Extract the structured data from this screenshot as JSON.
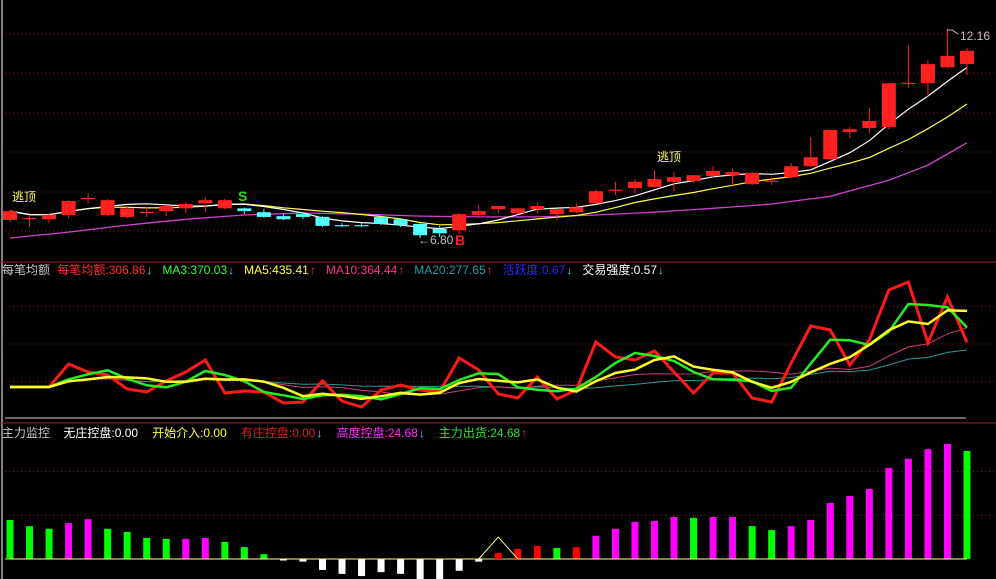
{
  "colors": {
    "up": "#ff2020",
    "down": "#54ffff",
    "ma5": "#ffffff",
    "ma10": "#ffff40",
    "ma_long": "#d040d0",
    "grid": "#8a1c1c",
    "amount": "#ff1a1a",
    "ma3_line": "#22ee22",
    "ma5_line": "#ffff22",
    "ma10_line": "#d03a80",
    "ma20_line": "#2a9a9a",
    "bar_g": "#00ff00",
    "bar_m": "#ff00ff",
    "bar_w": "#ffffff",
    "bar_r": "#ff0000",
    "signal_line": "#ffff80"
  },
  "price_panel": {
    "high_label": "12.16",
    "low_label": "←6.80",
    "signals": {
      "sell": "S",
      "buy": "B"
    },
    "escape_top_label": "逃顶"
  },
  "amount_panel": {
    "title": "每笔均额",
    "items": [
      {
        "label": "每笔均额:",
        "value": "306.86",
        "arrow": "↓",
        "color": "#ff3030",
        "arrow_color": "#40e0ff"
      },
      {
        "label": "MA3:",
        "value": "370.03",
        "arrow": "↓",
        "color": "#30ff30",
        "arrow_color": "#40e0ff"
      },
      {
        "label": "MA5:",
        "value": "435.41",
        "arrow": "↑",
        "color": "#ffff30",
        "arrow_color": "#ff3030"
      },
      {
        "label": "MA10:",
        "value": "364.44",
        "arrow": "↑",
        "color": "#ff3090",
        "arrow_color": "#ff3030"
      },
      {
        "label": "MA20:",
        "value": "277.65",
        "arrow": "↑",
        "color": "#20a0a0",
        "arrow_color": "#ff3030"
      },
      {
        "label": "活跃度:",
        "value": "0.67",
        "arrow": "↓",
        "color": "#2828ff",
        "arrow_color": "#40e0ff"
      },
      {
        "label": "交易强度:",
        "value": "0.57",
        "arrow": "↓",
        "color": "#ffffff",
        "arrow_color": "#40e0ff"
      }
    ]
  },
  "control_panel": {
    "title": "主力监控",
    "items": [
      {
        "label": "无庄控盘:",
        "value": "0.00",
        "arrow": "",
        "color": "#ffffff",
        "arrow_color": "#ffffff"
      },
      {
        "label": "开始介入:",
        "value": "0.00",
        "arrow": "",
        "color": "#ffff30",
        "arrow_color": "#ffffff"
      },
      {
        "label": "有庄控盘:",
        "value": "0.00",
        "arrow": "↓",
        "color": "#e02020",
        "arrow_color": "#40e0ff"
      },
      {
        "label": "高度控盘:",
        "value": "24.68",
        "arrow": "↓",
        "color": "#ff30ff",
        "arrow_color": "#40e0ff"
      },
      {
        "label": "主力出货:",
        "value": "24.68",
        "arrow": "↑",
        "color": "#30e030",
        "arrow_color": "#ff3030"
      }
    ]
  },
  "chart_data": [
    {
      "type": "candlestick",
      "title": "price",
      "ylim": [
        6.8,
        12.16
      ],
      "fields": [
        "open",
        "high",
        "low",
        "close"
      ],
      "ohlc": [
        [
          7.26,
          7.51,
          7.21,
          7.49
        ],
        [
          7.28,
          7.36,
          7.08,
          7.31
        ],
        [
          7.28,
          7.44,
          7.18,
          7.39
        ],
        [
          7.39,
          7.77,
          7.31,
          7.75
        ],
        [
          7.82,
          7.95,
          7.69,
          7.83
        ],
        [
          7.39,
          7.8,
          7.36,
          7.77
        ],
        [
          7.34,
          7.64,
          7.31,
          7.56
        ],
        [
          7.46,
          7.59,
          7.34,
          7.47
        ],
        [
          7.49,
          7.64,
          7.36,
          7.62
        ],
        [
          7.56,
          7.72,
          7.44,
          7.67
        ],
        [
          7.69,
          7.85,
          7.46,
          7.77
        ],
        [
          7.56,
          7.8,
          7.54,
          7.77
        ],
        [
          7.56,
          7.58,
          7.41,
          7.49
        ],
        [
          7.46,
          7.54,
          7.32,
          7.34
        ],
        [
          7.36,
          7.41,
          7.26,
          7.28
        ],
        [
          7.41,
          7.46,
          7.28,
          7.34
        ],
        [
          7.34,
          7.36,
          7.08,
          7.11
        ],
        [
          7.13,
          7.18,
          7.08,
          7.12
        ],
        [
          7.13,
          7.18,
          7.08,
          7.12
        ],
        [
          7.34,
          7.36,
          7.13,
          7.16
        ],
        [
          7.28,
          7.31,
          7.08,
          7.13
        ],
        [
          7.16,
          7.18,
          6.8,
          6.87
        ],
        [
          7.03,
          7.11,
          6.82,
          6.92
        ],
        [
          7.0,
          7.44,
          6.9,
          7.41
        ],
        [
          7.39,
          7.64,
          7.34,
          7.49
        ],
        [
          7.54,
          7.62,
          7.44,
          7.62
        ],
        [
          7.44,
          7.56,
          7.41,
          7.56
        ],
        [
          7.54,
          7.69,
          7.44,
          7.62
        ],
        [
          7.41,
          7.54,
          7.26,
          7.54
        ],
        [
          7.46,
          7.69,
          7.44,
          7.59
        ],
        [
          7.69,
          8.03,
          7.67,
          8.0
        ],
        [
          8.02,
          8.24,
          7.9,
          8.04
        ],
        [
          8.08,
          8.31,
          7.95,
          8.24
        ],
        [
          8.11,
          8.54,
          8.08,
          8.31
        ],
        [
          8.24,
          8.49,
          8.0,
          8.36
        ],
        [
          8.26,
          8.41,
          8.21,
          8.41
        ],
        [
          8.39,
          8.64,
          8.36,
          8.52
        ],
        [
          8.41,
          8.57,
          8.11,
          8.49
        ],
        [
          8.18,
          8.49,
          8.16,
          8.47
        ],
        [
          8.25,
          8.36,
          8.16,
          8.27
        ],
        [
          8.36,
          8.72,
          8.33,
          8.64
        ],
        [
          8.64,
          9.39,
          8.62,
          8.87
        ],
        [
          8.82,
          9.57,
          8.8,
          9.57
        ],
        [
          9.52,
          9.65,
          9.36,
          9.59
        ],
        [
          9.62,
          10.13,
          9.49,
          9.8
        ],
        [
          9.65,
          10.77,
          9.59,
          10.77
        ],
        [
          10.76,
          11.75,
          10.65,
          10.78
        ],
        [
          10.77,
          11.36,
          10.42,
          11.26
        ],
        [
          11.18,
          12.16,
          11.15,
          11.47
        ],
        [
          11.26,
          11.67,
          10.98,
          11.6
        ]
      ],
      "ma_long_points": [
        [
          0,
          6.8
        ],
        [
          3,
          6.95
        ],
        [
          6,
          7.13
        ],
        [
          9,
          7.28
        ],
        [
          12,
          7.39
        ],
        [
          15,
          7.44
        ],
        [
          18,
          7.41
        ],
        [
          21,
          7.36
        ],
        [
          24,
          7.34
        ],
        [
          27,
          7.34
        ],
        [
          30,
          7.39
        ],
        [
          33,
          7.46
        ],
        [
          36,
          7.56
        ],
        [
          39,
          7.67
        ],
        [
          42,
          7.87
        ],
        [
          45,
          8.28
        ],
        [
          47,
          8.67
        ],
        [
          49,
          9.24
        ]
      ],
      "markers": {
        "escape_top": [
          1,
          34
        ],
        "sell": 12,
        "buy": 23,
        "low_index": 21,
        "high_index": 48
      }
    },
    {
      "type": "line",
      "title": "每笔均额",
      "ylim": [
        0,
        560
      ],
      "gridlines": [
        150,
        300,
        450
      ],
      "amount": [
        128,
        128,
        128,
        220,
        188,
        176,
        120,
        108,
        152,
        188,
        236,
        104,
        112,
        108,
        64,
        68,
        152,
        72,
        48,
        116,
        136,
        116,
        108,
        244,
        196,
        100,
        84,
        168,
        80,
        116,
        308,
        248,
        236,
        272,
        188,
        104,
        184,
        184,
        84,
        68,
        224,
        372,
        356,
        216,
        316,
        516,
        548,
        304,
        488,
        306.86
      ],
      "ma_periods": [
        3,
        5,
        10,
        20
      ]
    },
    {
      "type": "bar",
      "title": "主力监控",
      "ylim": [
        -5,
        28
      ],
      "gridlines": [
        10,
        20
      ],
      "values": [
        8.9,
        7.5,
        6.9,
        8.2,
        9.1,
        6.9,
        6.2,
        4.8,
        4.6,
        4.6,
        4.8,
        3.9,
        2.7,
        1.1,
        -0.3,
        -0.6,
        -2.5,
        -3.4,
        -3.9,
        -3.0,
        -3.4,
        -4.6,
        -4.6,
        -2.7,
        -0.6,
        1.4,
        2.3,
        3.0,
        2.5,
        2.7,
        5.3,
        6.9,
        8.5,
        8.7,
        9.6,
        9.4,
        9.6,
        9.6,
        7.5,
        6.6,
        7.5,
        8.9,
        12.8,
        14.4,
        16.0,
        20.8,
        22.9,
        25.1,
        26.3,
        24.68
      ],
      "bar_colors": [
        "g",
        "g",
        "g",
        "m",
        "m",
        "g",
        "g",
        "g",
        "g",
        "m",
        "m",
        "g",
        "g",
        "g",
        "w",
        "w",
        "w",
        "w",
        "w",
        "w",
        "w",
        "w",
        "w",
        "w",
        "w",
        "r",
        "r",
        "r",
        "g",
        "r",
        "m",
        "m",
        "m",
        "m",
        "m",
        "g",
        "m",
        "m",
        "g",
        "g",
        "m",
        "m",
        "m",
        "m",
        "m",
        "m",
        "m",
        "m",
        "m",
        "g"
      ],
      "signal_line": [
        0,
        0,
        0,
        0,
        0,
        0,
        0,
        0,
        0,
        0,
        0,
        0,
        0,
        0,
        0,
        0,
        0,
        0,
        0,
        0,
        0,
        0,
        0,
        0,
        0,
        5.0,
        0,
        0,
        0,
        0,
        0,
        0,
        0,
        0,
        0,
        0,
        0,
        0,
        0,
        0,
        0,
        0,
        0,
        0,
        0,
        0,
        0,
        0,
        0,
        0
      ]
    }
  ]
}
